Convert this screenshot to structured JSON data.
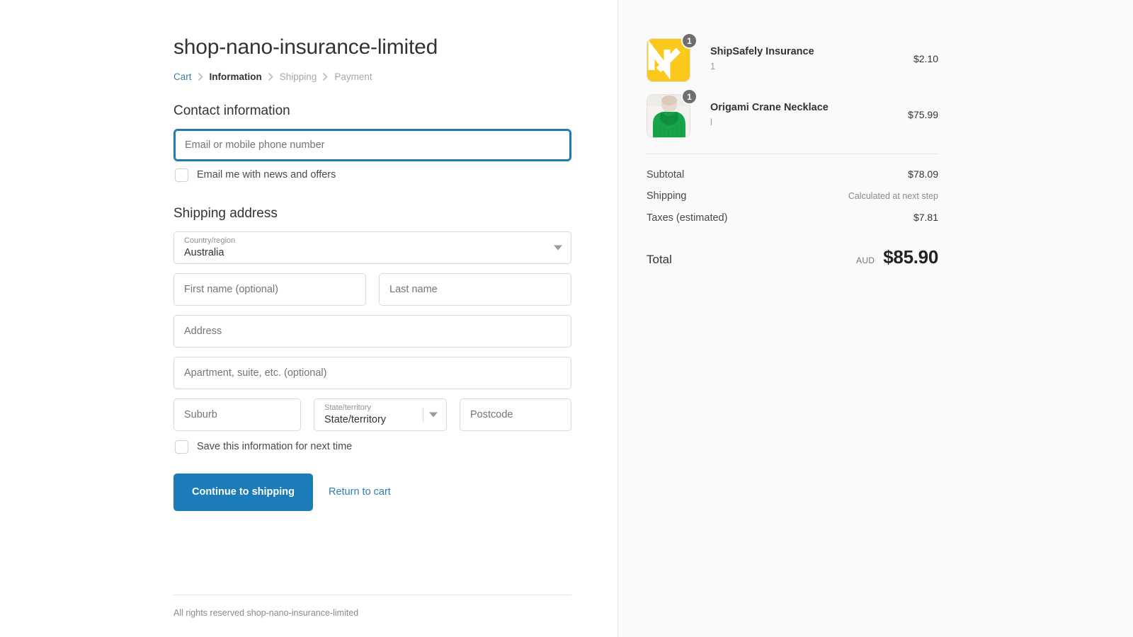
{
  "shop": {
    "title": "shop-nano-insurance-limited",
    "footer_text": "All rights reserved shop-nano-insurance-limited"
  },
  "breadcrumb": {
    "cart": "Cart",
    "information": "Information",
    "shipping": "Shipping",
    "payment": "Payment"
  },
  "contact": {
    "heading": "Contact information",
    "email_placeholder": "Email or mobile phone number",
    "email_value": "",
    "newsletter_label": "Email me with news and offers",
    "newsletter_checked": false
  },
  "shipping_address": {
    "heading": "Shipping address",
    "country_label": "Country/region",
    "country_value": "Australia",
    "first_name_placeholder": "First name (optional)",
    "first_name_value": "",
    "last_name_placeholder": "Last name",
    "last_name_value": "",
    "address_placeholder": "Address",
    "address_value": "",
    "apartment_placeholder": "Apartment, suite, etc. (optional)",
    "apartment_value": "",
    "suburb_placeholder": "Suburb",
    "suburb_value": "",
    "state_label": "State/territory",
    "state_value": "State/territory",
    "postcode_placeholder": "Postcode",
    "postcode_value": "",
    "save_info_label": "Save this information for next time",
    "save_info_checked": false
  },
  "actions": {
    "continue_label": "Continue to shipping",
    "return_label": "Return to cart"
  },
  "order_summary": {
    "items": [
      {
        "name": "ShipSafely Insurance",
        "variant": "1",
        "price": "$2.10",
        "quantity": "1",
        "image": "shipsafely-logo"
      },
      {
        "name": "Origami Crane Necklace",
        "variant": "l",
        "price": "$75.99",
        "quantity": "1",
        "image": "green-sweater-photo"
      }
    ],
    "subtotal_label": "Subtotal",
    "subtotal_value": "$78.09",
    "shipping_label": "Shipping",
    "shipping_value": "Calculated at next step",
    "taxes_label": "Taxes (estimated)",
    "taxes_value": "$7.81",
    "total_label": "Total",
    "total_currency": "AUD",
    "total_value": "$85.90"
  },
  "colors": {
    "accent": "#1c7cb8",
    "link": "#3b7ca8",
    "focus_border": "#1f7ab0",
    "sidebar_bg": "#fafafa",
    "badge_bg": "#6e6e6e",
    "logo_yellow": "#fbc91b",
    "sweater_green": "#16a34a"
  }
}
